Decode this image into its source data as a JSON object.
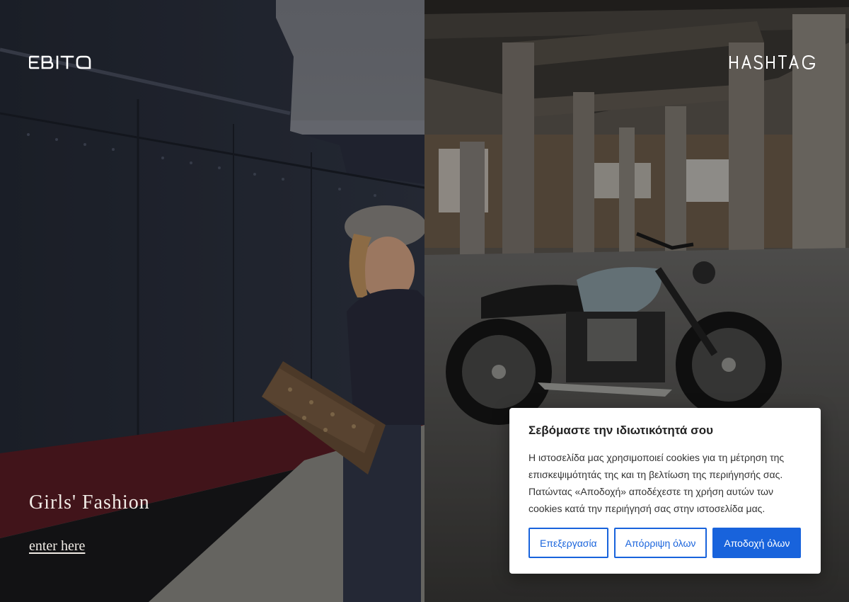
{
  "left_panel": {
    "logo_text": "EBITA",
    "title": "Girls' Fashion",
    "link_label": "enter here"
  },
  "right_panel": {
    "logo_text": "HASHTAG"
  },
  "cookie_banner": {
    "title": "Σεβόμαστε την ιδιωτικότητά σου",
    "body": "Η ιστοσελίδα μας χρησιμοποιεί cookies για τη μέτρηση της επισκεψιμότητάς της και τη βελτίωση της περιήγησής σας. Πατώντας «Αποδοχή» αποδέχεστε τη χρήση αυτών των cookies κατά την περιήγησή σας στην ιστοσελίδα μας.",
    "customize_label": "Επεξεργασία",
    "reject_label": "Απόρριψη όλων",
    "accept_label": "Αποδοχή όλων",
    "accent_color": "#1863dc"
  }
}
